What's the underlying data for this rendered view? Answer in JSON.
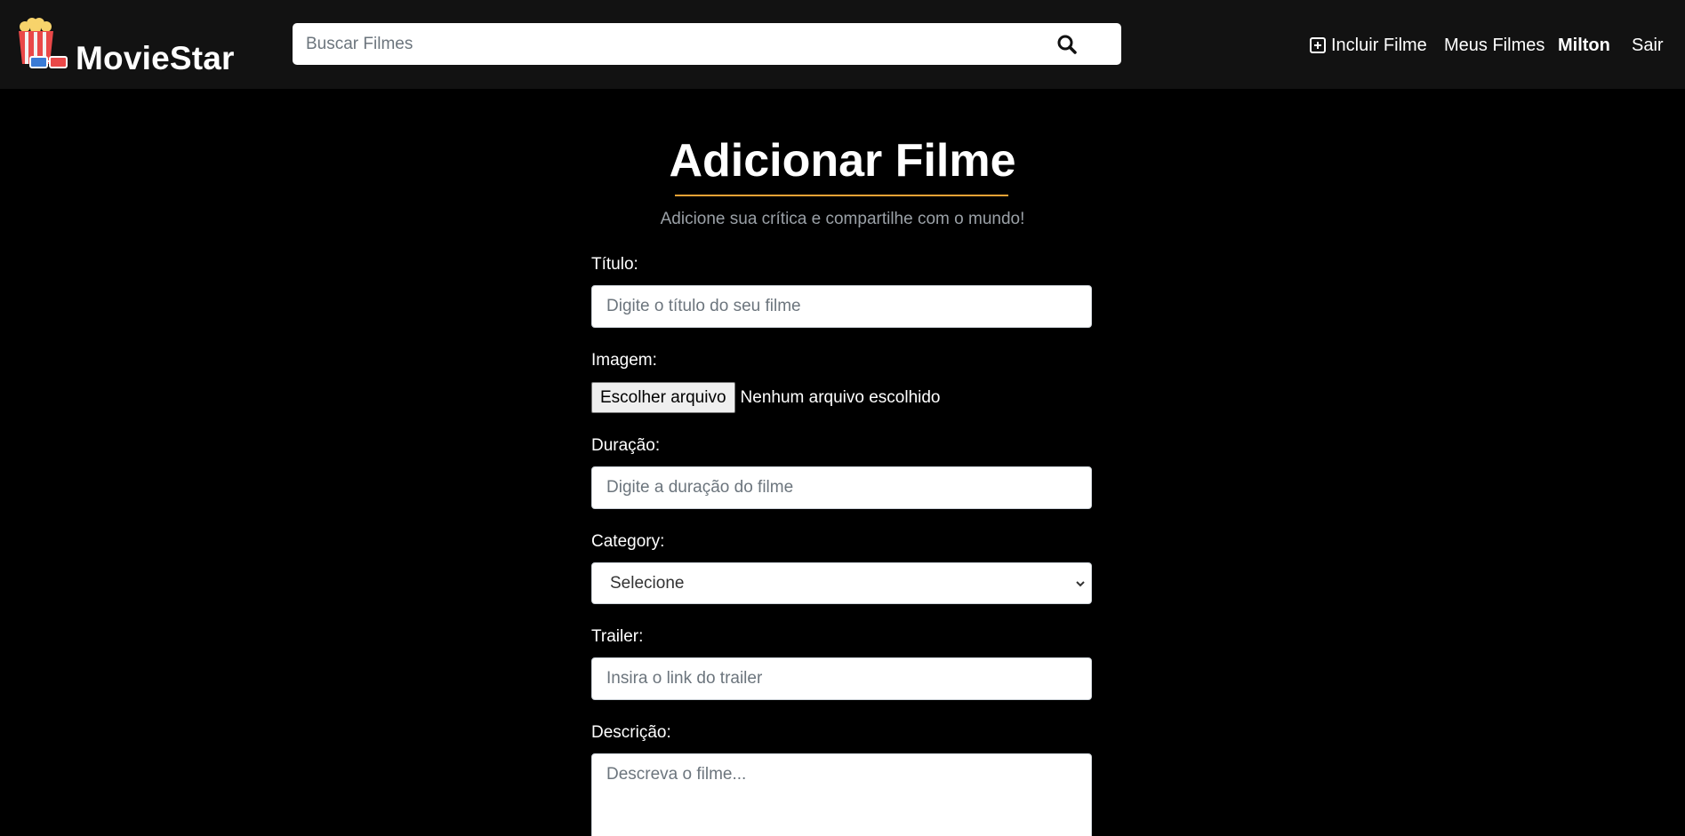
{
  "header": {
    "brand": "MovieStar",
    "search_placeholder": "Buscar Filmes",
    "nav": {
      "add_movie": "Incluir Filme",
      "my_movies": "Meus Filmes",
      "user": "Milton",
      "logout": "Sair"
    },
    "icons": {
      "logo": "popcorn-3d-glasses-icon",
      "search": "search-icon",
      "add": "plus-square-icon"
    }
  },
  "main": {
    "title": "Adicionar Filme",
    "subtitle": "Adicione sua crítica e compartilhe com o mundo!",
    "form": {
      "title_label": "Título:",
      "title_placeholder": "Digite o título do seu filme",
      "image_label": "Imagem:",
      "file_button": "Escolher arquivo",
      "file_status": "Nenhum arquivo escolhido",
      "duration_label": "Duração:",
      "duration_placeholder": "Digite a duração do filme",
      "category_label": "Category:",
      "category_selected": "Selecione",
      "trailer_label": "Trailer:",
      "trailer_placeholder": "Insira o link do trailer",
      "description_label": "Descrição:",
      "description_placeholder": "Descreva o filme..."
    }
  },
  "colors": {
    "header_bg": "#121212",
    "page_bg": "#000000",
    "accent": "#f0a335"
  }
}
